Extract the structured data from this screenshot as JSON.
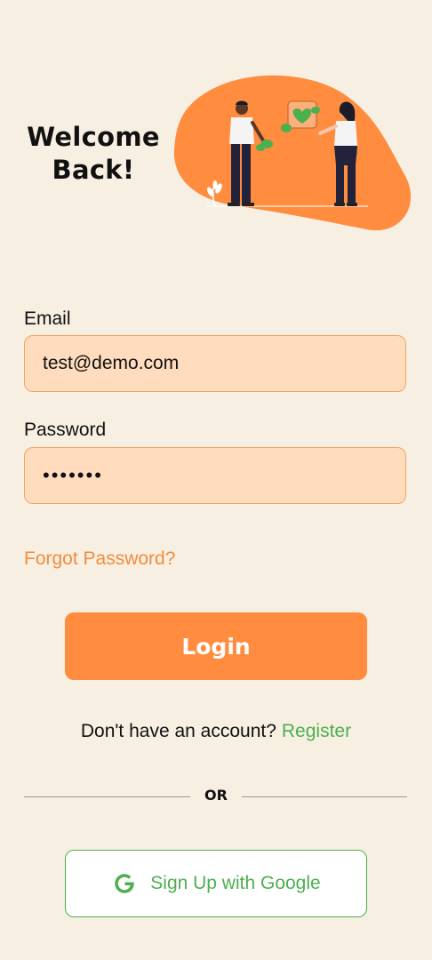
{
  "header": {
    "title_line1": "Welcome",
    "title_line2": "Back!",
    "illustration_icon": "two-people-sharing-heart-illustration"
  },
  "colors": {
    "background": "#f7efe2",
    "accent": "#ff8c3f",
    "field_fill": "#ffdcbd",
    "link_orange": "#f28c3e",
    "green": "#4caf50"
  },
  "form": {
    "email_label": "Email",
    "email_value": "test@demo.com",
    "password_label": "Password",
    "password_value": "•••••••",
    "forgot_label": "Forgot Password?",
    "login_label": "Login"
  },
  "register": {
    "prompt": "Don't have an account?",
    "link": "Register"
  },
  "divider": {
    "text": "OR"
  },
  "google": {
    "label": "Sign Up with Google",
    "icon": "google-icon"
  }
}
